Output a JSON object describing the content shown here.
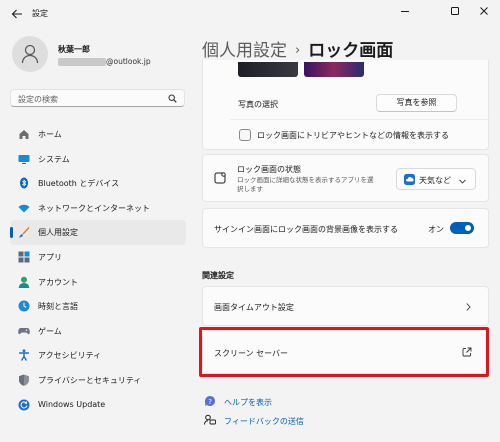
{
  "window": {
    "title": "設定"
  },
  "user": {
    "name": "秋葉一郎",
    "email_domain": "@outlook.jp"
  },
  "search": {
    "placeholder": "設定の検索"
  },
  "sidebar": {
    "items": [
      {
        "label": "ホーム",
        "icon": "home-icon"
      },
      {
        "label": "システム",
        "icon": "system-icon"
      },
      {
        "label": "Bluetooth とデバイス",
        "icon": "bluetooth-icon"
      },
      {
        "label": "ネットワークとインターネット",
        "icon": "wifi-icon"
      },
      {
        "label": "個人用設定",
        "icon": "brush-icon",
        "active": true
      },
      {
        "label": "アプリ",
        "icon": "apps-icon"
      },
      {
        "label": "アカウント",
        "icon": "account-icon"
      },
      {
        "label": "時刻と言語",
        "icon": "time-language-icon"
      },
      {
        "label": "ゲーム",
        "icon": "gaming-icon"
      },
      {
        "label": "アクセシビリティ",
        "icon": "accessibility-icon"
      },
      {
        "label": "プライバシーとセキュリティ",
        "icon": "shield-icon"
      },
      {
        "label": "Windows Update",
        "icon": "windows-update-icon"
      }
    ]
  },
  "breadcrumb": {
    "parent": "個人用設定",
    "separator": "›",
    "current": "ロック画面"
  },
  "main": {
    "photo_select": {
      "label": "写真の選択",
      "button": "写真を参照"
    },
    "trivia_checkbox": {
      "label": "ロック画面にトリビアやヒントなどの情報を表示する",
      "checked": false
    },
    "lock_status": {
      "title": "ロック画面の状態",
      "description_line1": "ロック画面に詳細な状態を表示するアプリを選",
      "description_line2": "択します",
      "dropdown_value": "天気など"
    },
    "signin_background": {
      "label": "サインイン画面にロック画面の背景画像を表示する",
      "state_label": "オン",
      "on": true
    },
    "related": {
      "header": "関連設定",
      "timeout": "画面タイムアウト設定",
      "screensaver": "スクリーン セーバー"
    },
    "links": {
      "help": "ヘルプを表示",
      "feedback": "フィードバックの送信"
    }
  },
  "colors": {
    "accent": "#005fb8",
    "highlight_border": "#e0141e"
  }
}
